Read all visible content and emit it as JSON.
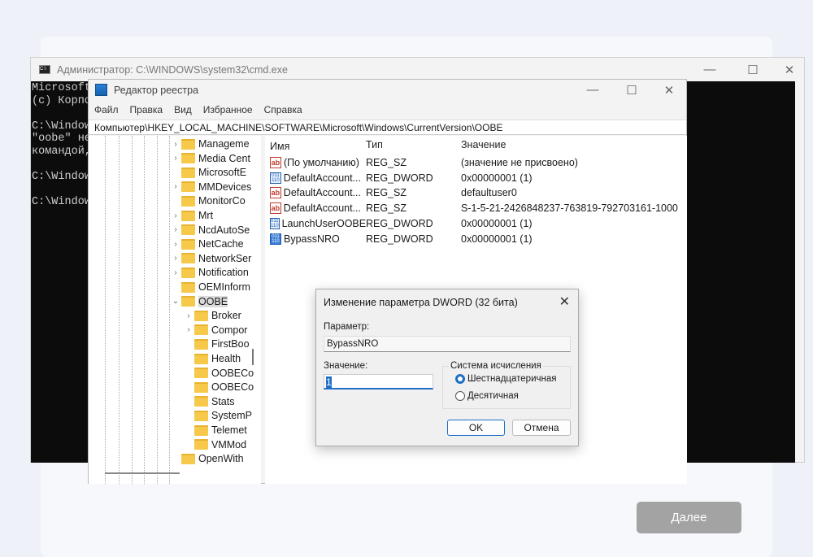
{
  "oobe": {
    "next_label": "Далее"
  },
  "cmd": {
    "title": "Администратор: C:\\WINDOWS\\system32\\cmd.exe",
    "icon": "C:\\",
    "lines": [
      "Microsoft",
      "(c) Корпо",
      "",
      "C:\\Window",
      "\"oobe\" не",
      "командой,",
      "",
      "C:\\Window",
      "",
      "C:\\Window"
    ]
  },
  "regedit": {
    "title": "Редактор реестра",
    "menu": [
      "Файл",
      "Правка",
      "Вид",
      "Избранное",
      "Справка"
    ],
    "address": "Компьютер\\HKEY_LOCAL_MACHINE\\SOFTWARE\\Microsoft\\Windows\\CurrentVersion\\OOBE",
    "tree": [
      {
        "label": "Manageme",
        "depth": 0,
        "expand": "collapsed"
      },
      {
        "label": "Media Cent",
        "depth": 0,
        "expand": "collapsed"
      },
      {
        "label": "MicrosoftE",
        "depth": 0,
        "expand": "none"
      },
      {
        "label": "MMDevices",
        "depth": 0,
        "expand": "collapsed"
      },
      {
        "label": "MonitorCo",
        "depth": 0,
        "expand": "none"
      },
      {
        "label": "Mrt",
        "depth": 0,
        "expand": "collapsed"
      },
      {
        "label": "NcdAutoSe",
        "depth": 0,
        "expand": "collapsed"
      },
      {
        "label": "NetCache",
        "depth": 0,
        "expand": "collapsed"
      },
      {
        "label": "NetworkSer",
        "depth": 0,
        "expand": "collapsed"
      },
      {
        "label": "Notification",
        "depth": 0,
        "expand": "collapsed"
      },
      {
        "label": "OEMInform",
        "depth": 0,
        "expand": "none"
      },
      {
        "label": "OOBE",
        "depth": 0,
        "expand": "expanded",
        "selected": true
      },
      {
        "label": "Broker",
        "depth": 1,
        "expand": "collapsed"
      },
      {
        "label": "Compor",
        "depth": 1,
        "expand": "collapsed"
      },
      {
        "label": "FirstBoo",
        "depth": 1,
        "expand": "none"
      },
      {
        "label": "Health",
        "depth": 1,
        "expand": "none"
      },
      {
        "label": "OOBECo",
        "depth": 1,
        "expand": "none"
      },
      {
        "label": "OOBECo",
        "depth": 1,
        "expand": "none"
      },
      {
        "label": "Stats",
        "depth": 1,
        "expand": "none"
      },
      {
        "label": "SystemP",
        "depth": 1,
        "expand": "none"
      },
      {
        "label": "Telemet",
        "depth": 1,
        "expand": "none"
      },
      {
        "label": "VMMod",
        "depth": 1,
        "expand": "none"
      },
      {
        "label": "OpenWith",
        "depth": 0,
        "expand": "none"
      }
    ],
    "columns": [
      "Имя",
      "Тип",
      "Значение"
    ],
    "values": [
      {
        "icon": "string",
        "name": "(По умолчанию)",
        "type": "REG_SZ",
        "data": "(значение не присвоено)"
      },
      {
        "icon": "binary",
        "name": "DefaultAccount...",
        "type": "REG_DWORD",
        "data": "0x00000001 (1)"
      },
      {
        "icon": "string",
        "name": "DefaultAccount...",
        "type": "REG_SZ",
        "data": "defaultuser0"
      },
      {
        "icon": "string",
        "name": "DefaultAccount...",
        "type": "REG_SZ",
        "data": "S-1-5-21-2426848237-763819-792703161-1000"
      },
      {
        "icon": "binary",
        "name": "LaunchUserOOBE",
        "type": "REG_DWORD",
        "data": "0x00000001 (1)"
      },
      {
        "icon": "binary",
        "name": "BypassNRO",
        "type": "REG_DWORD",
        "data": "0x00000001 (1)",
        "highlighted": true
      }
    ]
  },
  "dialog": {
    "title": "Изменение параметра DWORD (32 бита)",
    "param_label": "Параметр:",
    "param_value": "BypassNRO",
    "value_label": "Значение:",
    "value": "1",
    "base_group": "Система исчисления",
    "hex_label": "Шестнадцатеричная",
    "dec_label": "Десятичная",
    "selected_base": "hex",
    "ok": "OK",
    "cancel": "Отмена"
  }
}
